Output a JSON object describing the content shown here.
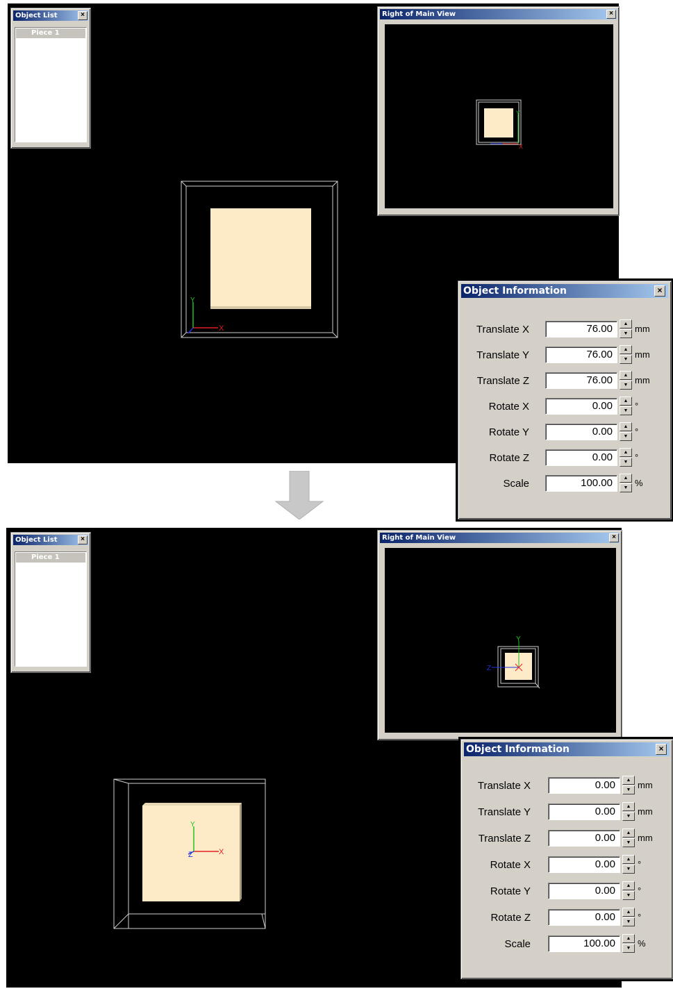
{
  "top": {
    "object_list": {
      "title": "Object List",
      "items": [
        "Piece 1"
      ]
    },
    "right_view": {
      "title": "Right of Main View"
    },
    "object_info": {
      "title": "Object Information",
      "rows": [
        {
          "label": "Translate X",
          "value": "76.00",
          "unit": "mm"
        },
        {
          "label": "Translate Y",
          "value": "76.00",
          "unit": "mm"
        },
        {
          "label": "Translate Z",
          "value": "76.00",
          "unit": "mm"
        },
        {
          "label": "Rotate X",
          "value": "0.00",
          "unit": "°"
        },
        {
          "label": "Rotate Y",
          "value": "0.00",
          "unit": "°"
        },
        {
          "label": "Rotate Z",
          "value": "0.00",
          "unit": "°"
        },
        {
          "label": "Scale",
          "value": "100.00",
          "unit": "%"
        }
      ]
    }
  },
  "bottom": {
    "object_list": {
      "title": "Object List",
      "items": [
        "Piece 1"
      ]
    },
    "right_view": {
      "title": "Right of Main View"
    },
    "object_info": {
      "title": "Object Information",
      "rows": [
        {
          "label": "Translate X",
          "value": "0.00",
          "unit": "mm"
        },
        {
          "label": "Translate Y",
          "value": "0.00",
          "unit": "mm"
        },
        {
          "label": "Translate Z",
          "value": "0.00",
          "unit": "mm"
        },
        {
          "label": "Rotate X",
          "value": "0.00",
          "unit": "°"
        },
        {
          "label": "Rotate Y",
          "value": "0.00",
          "unit": "°"
        },
        {
          "label": "Rotate Z",
          "value": "0.00",
          "unit": "°"
        },
        {
          "label": "Scale",
          "value": "100.00",
          "unit": "%"
        }
      ]
    }
  },
  "axes": {
    "x": "X",
    "y": "Y",
    "z": "Z"
  },
  "colors": {
    "piece": "#fdebc8",
    "axis_x": "#e02020",
    "axis_y": "#20c020",
    "axis_z": "#2030e0"
  }
}
